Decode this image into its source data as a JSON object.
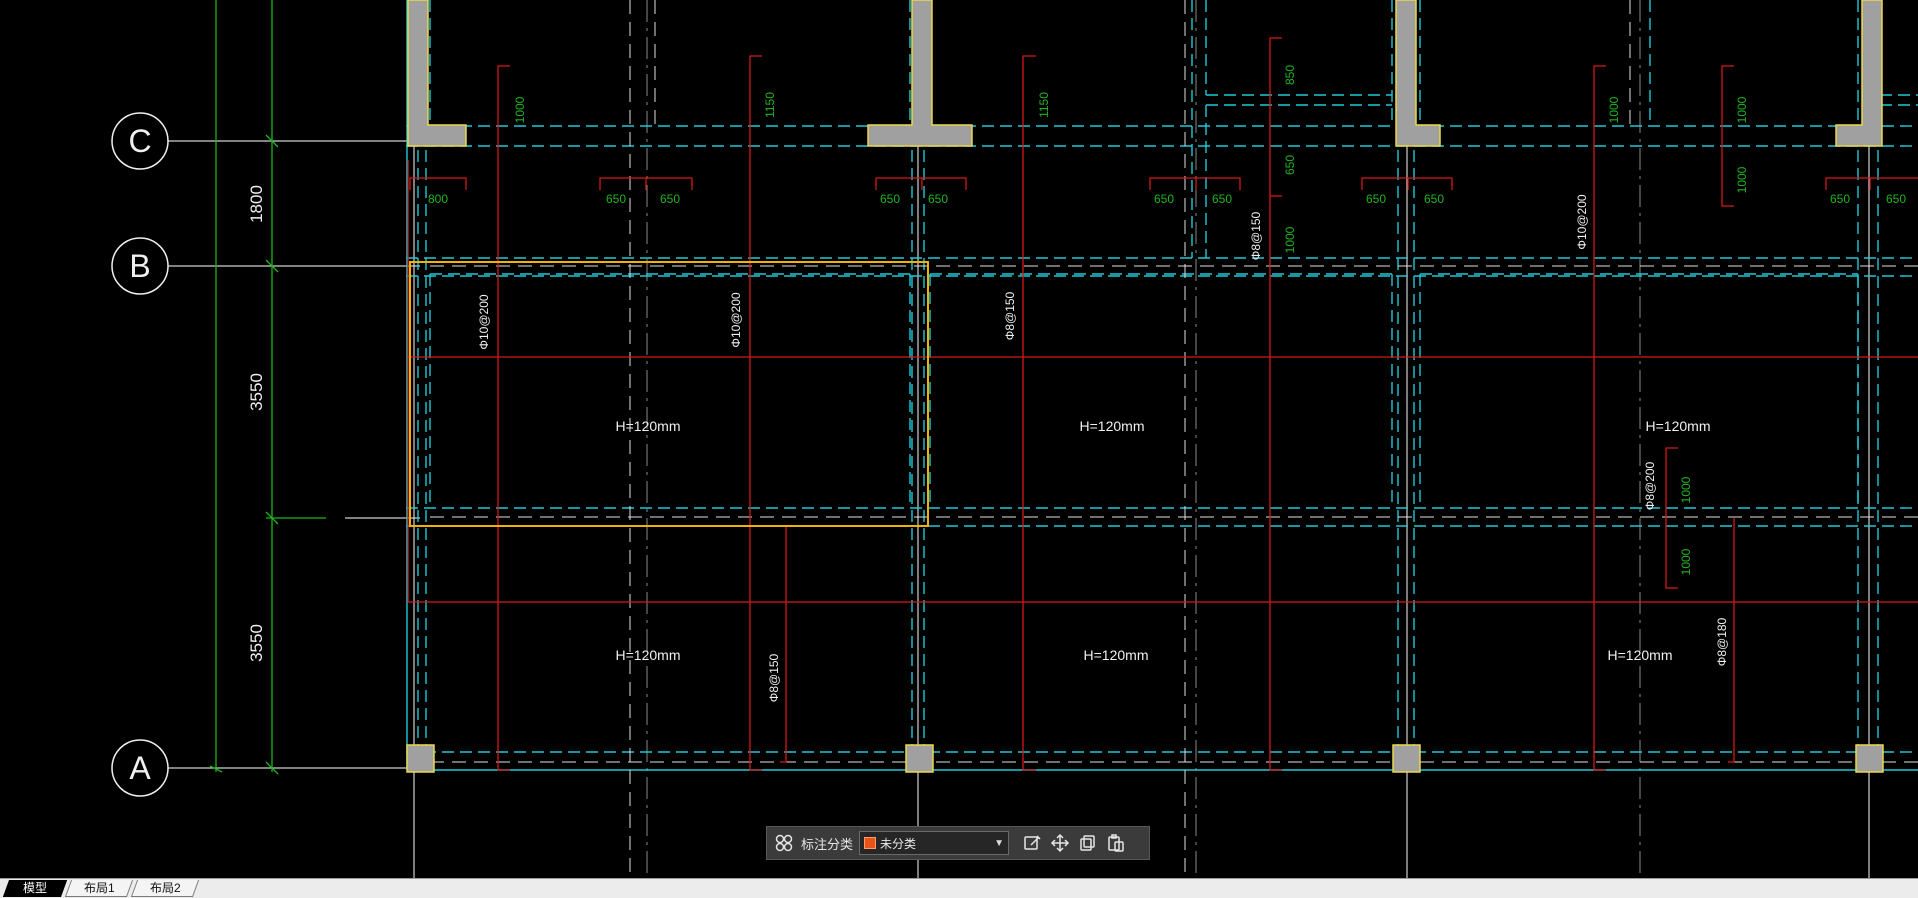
{
  "drawing": {
    "grid_labels": {
      "c": "C",
      "b": "B",
      "a": "A"
    },
    "row_dims": [
      "1800",
      "3550",
      "3550"
    ],
    "top_dims": [
      "1000",
      "1150",
      "1150",
      "850",
      "650",
      "1000",
      "1000",
      "1000",
      "1000"
    ],
    "slab_dims": {
      "d800": "800",
      "d650": "650",
      "d1000": "1000"
    },
    "rebar": {
      "phi10_200": "Φ10@200",
      "phi8_150": "Φ8@150",
      "phi8_200": "Φ8@200",
      "phi8_180": "Φ8@180"
    },
    "slab_thickness": "H=120mm",
    "colors": {
      "background": "#000000",
      "column": "#a0a0a0",
      "column_edge": "#e8d84a",
      "beam_dash": "#20c8d8",
      "rebar": "#d41a1a",
      "dimension_green": "#1fb41f",
      "axis_line": "#d0d0d0",
      "selection": "#f0b400",
      "text_white": "#f0f0f0"
    }
  },
  "toolbar": {
    "label": "标注分类",
    "selected": "未分类",
    "swatch_color": "#e8541c",
    "icons": [
      "grid-icon",
      "edit-icon",
      "move-icon",
      "copy-icon",
      "paste-icon"
    ]
  },
  "tabs": [
    {
      "label": "模型",
      "active": true
    },
    {
      "label": "布局1",
      "active": false
    },
    {
      "label": "布局2",
      "active": false
    }
  ]
}
